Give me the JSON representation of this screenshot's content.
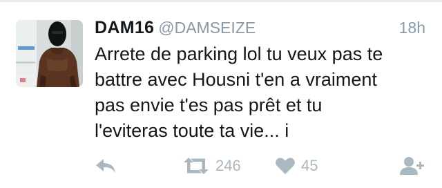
{
  "tweet": {
    "display_name": "DAM16",
    "handle": "@DAMSEIZE",
    "time": "18h",
    "text_lines": [
      "Arrete de parking lol tu veux pas te",
      "battre avec Housni t'en a vraiment",
      "pas envie t'es pas prêt et tu",
      "l'eviteras toute ta vie... i"
    ]
  },
  "actions": {
    "reply_icon": "reply-icon",
    "retweet_icon": "retweet-icon",
    "retweet_count": "246",
    "like_icon": "heart-icon",
    "like_count": "45",
    "follow_icon": "add-user-icon"
  },
  "colors": {
    "text": "#14171a",
    "muted": "#8899a6",
    "action": "#aab8c2",
    "divider": "#e6ecf0"
  }
}
